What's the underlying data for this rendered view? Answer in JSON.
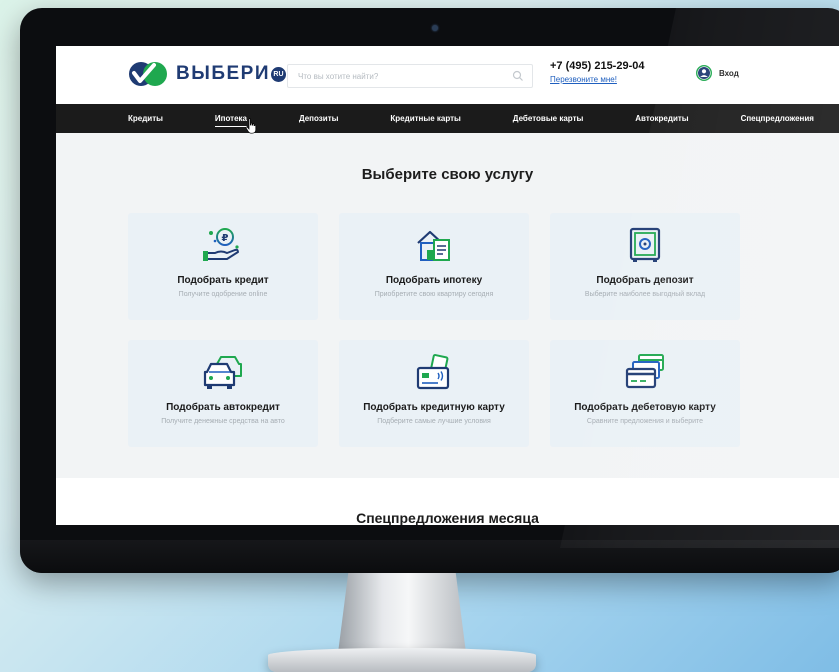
{
  "brand": {
    "logo_text": "ВЫБЕРИ",
    "logo_badge": "RU",
    "color_primary": "#1f3b73",
    "color_green": "#1fa84f"
  },
  "header": {
    "search_placeholder": "Что вы хотите найти?",
    "phone": "+7 (495) 215-29-04",
    "callback_link": "Перезвоните мне!",
    "login_label": "Вход"
  },
  "nav": {
    "items": [
      {
        "label": "Кредиты"
      },
      {
        "label": "Ипотека"
      },
      {
        "label": "Депозиты"
      },
      {
        "label": "Кредитные карты"
      },
      {
        "label": "Дебетовые карты"
      },
      {
        "label": "Автокредиты"
      },
      {
        "label": "Спецпредложения"
      }
    ],
    "active_index": 1
  },
  "main": {
    "title": "Выберите свою услугу",
    "cards": [
      {
        "title": "Подобрать кредит",
        "subtitle": "Получите одобрение online",
        "icon": "money-hand-icon"
      },
      {
        "title": "Подобрать ипотеку",
        "subtitle": "Приобретите свою квартиру сегодня",
        "icon": "house-document-icon"
      },
      {
        "title": "Подобрать депозит",
        "subtitle": "Выберите наиболее выгодный вклад",
        "icon": "safe-icon"
      },
      {
        "title": "Подобрать автокредит",
        "subtitle": "Получите денежные средства на авто",
        "icon": "car-icon"
      },
      {
        "title": "Подобрать кредитную карту",
        "subtitle": "Подберите самые лучшие условия",
        "icon": "credit-card-contactless-icon"
      },
      {
        "title": "Подобрать дебетовую карту",
        "subtitle": "Сравните предложения и выберите",
        "icon": "debit-cards-icon"
      }
    ],
    "specials_title": "Спецпредложения месяца"
  }
}
